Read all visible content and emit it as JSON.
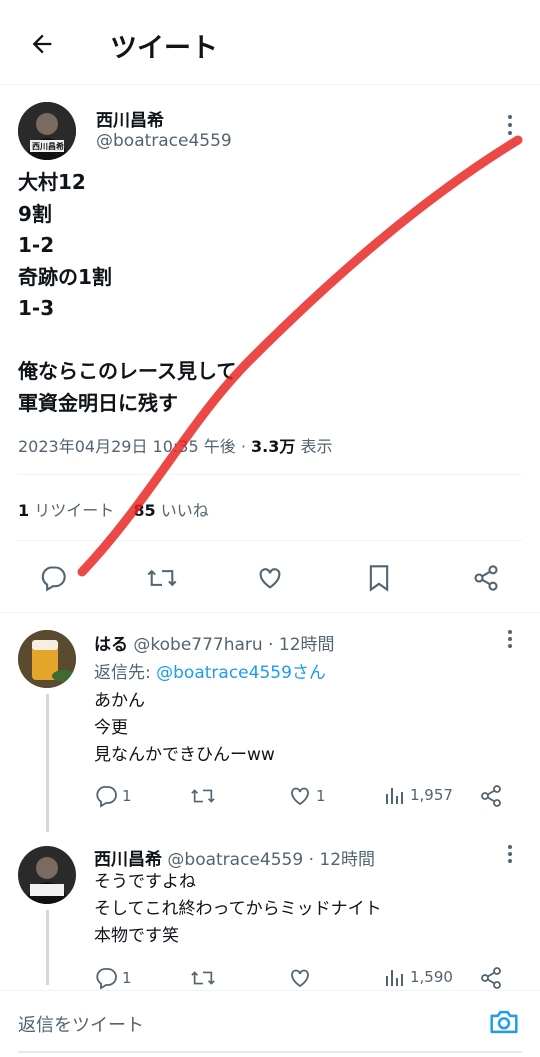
{
  "header": {
    "title": "ツイート"
  },
  "tweet": {
    "author_name": "西川昌希",
    "author_handle": "@boatrace4559",
    "avatar_badge": "西川昌希",
    "lines": [
      "大村12",
      "9割",
      "1-2",
      "奇跡の1割",
      "1-3",
      "",
      "俺ならこのレース見して",
      "軍資金明日に残す"
    ],
    "datetime": "2023年04月29日 10:35 午後",
    "separator": "·",
    "views_count": "3.3万",
    "views_label": "表示",
    "retweets_count": "1",
    "retweets_label": "リツイート",
    "likes_count": "85",
    "likes_label": "いいね"
  },
  "replies": [
    {
      "name": "はる",
      "handle": "@kobe777haru",
      "time": "· 12時間",
      "reply_to_prefix": "返信先: ",
      "reply_to": "@boatrace4559さん",
      "lines": [
        "あかん",
        "今更",
        "見なんかできひんーww"
      ],
      "reply_count": "1",
      "retweet_count": "",
      "like_count": "1",
      "view_count": "1,957"
    },
    {
      "name": "西川昌希",
      "handle": "@boatrace4559",
      "time": "· 12時間",
      "lines": [
        "そうですよね",
        "そしてこれ終わってからミッドナイト",
        "本物です笑"
      ],
      "reply_count": "1",
      "retweet_count": "",
      "like_count": "",
      "view_count": "1,590"
    }
  ],
  "composer": {
    "placeholder": "返信をツイート"
  },
  "colors": {
    "accent": "#1d9bf0",
    "text": "#0f1419",
    "muted": "#536471",
    "annotation": "#e8201c"
  }
}
